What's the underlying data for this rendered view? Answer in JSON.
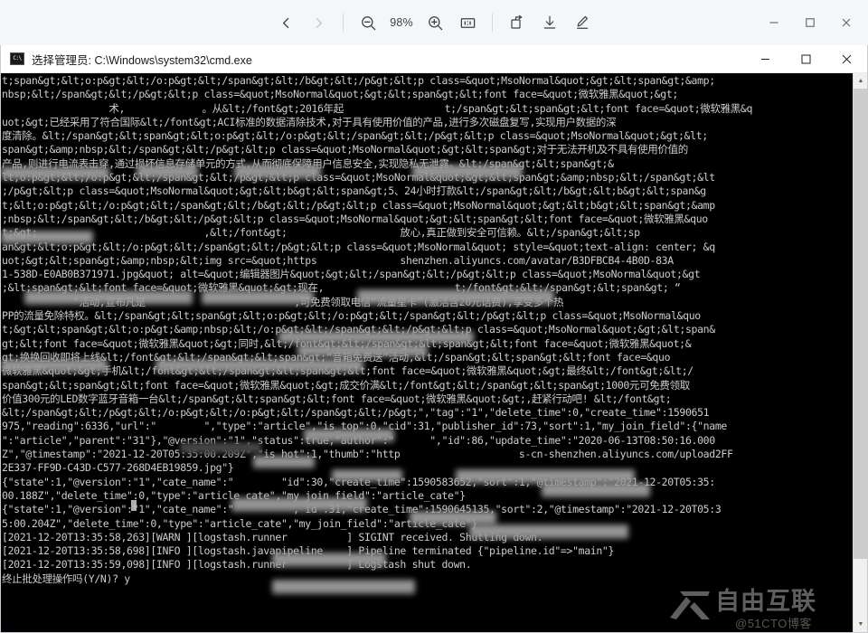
{
  "viewer": {
    "zoom_level": "98%",
    "buttons": {
      "prev": "prev-image",
      "next": "next-image",
      "zoom_out": "zoom-out",
      "zoom_in": "zoom-in",
      "actual_size": "1:1",
      "rotate": "rotate",
      "download": "download",
      "annotate": "annotate",
      "minimize": "−",
      "maximize": "□",
      "close": "✕"
    }
  },
  "cmd_window": {
    "icon_label": "C:\\",
    "title": "选择管理员: C:\\Windows\\system32\\cmd.exe",
    "controls": {
      "minimize": "−",
      "maximize": "□",
      "close": "✕"
    },
    "scrollbar": {
      "up_arrow": "▲",
      "down_arrow": "▼"
    }
  },
  "console": {
    "lines": [
      "t;span&gt;&lt;o:p&gt;&lt;/o:p&gt;&lt;/span&gt;&lt;/b&gt;&lt;/p&gt;&lt;p class=&quot;MsoNormal&quot;&gt;&lt;span&gt;&amp;",
      "nbsp;&lt;/span&gt;&lt;/p&gt;&lt;p class=&quot;MsoNormal&quot;&gt;&lt;span&gt;&lt;font face=&quot;微软雅黑&quot;&gt;",
      "                  术,             。从&lt;/font&gt;2016年起                 t;/span&gt;&lt;span&gt;&lt;font face=&quot;微软雅黑&q",
      "uot;&gt;已经采用了符合国际&lt;/font&gt;ACI标准的数据清除技术,对于具有使用价值的产品,进行多次磁盘复写,实现用户数据的深",
      "度清除。&lt;/span&gt;&lt;span&gt;&lt;o:p&gt;&lt;/o:p&gt;&lt;/span&gt;&lt;/p&gt;&lt;p class=&quot;MsoNormal&quot;&gt;&lt;",
      "span&gt;&amp;nbsp;&lt;/span&gt;&lt;/p&gt;&lt;p class=&quot;MsoNormal&quot;&gt;&lt;span&gt;对于无法开机及不具有使用价值的",
      "产品,则进行电流表击穿,通过损坏信息存储单元的方式,从而彻底保障用户信息安全,实现隐私无泄露。&lt;/span&gt;&lt;span&gt;&",
      "lt;o:p&gt;&lt;/o:p&gt;&lt;/span&gt;&lt;/p&gt;&lt;p class=&quot;MsoNormal&quot;&gt;&lt;span&gt;&amp;nbsp;&lt;/span&gt;&lt",
      ";/p&gt;&lt;p class=&quot;MsoNormal&quot;&gt;&lt;b&gt;&lt;span&gt;5、24小时打款&lt;/span&gt;&lt;/b&gt;&lt;b&gt;&lt;span&g",
      "t;&lt;o:p&gt;&lt;/o:p&gt;&lt;/span&gt;&lt;/b&gt;&lt;/p&gt;&lt;p class=&quot;MsoNormal&quot;&gt;&lt;b&gt;&lt;span&gt;&amp",
      ";nbsp;&lt;/span&gt;&lt;/b&gt;&lt;/p&gt;&lt;p class=&quot;MsoNormal&quot;&gt;&lt;span&gt;&lt;font face=&quot;微软雅黑&quo",
      "t;&gt;                            ,&lt;/font&gt;                   放心,真正做到安全可信赖。&lt;/span&gt;&lt;sp",
      "an&gt;&lt;o:p&gt;&lt;/o:p&gt;&lt;/span&gt;&lt;/p&gt;&lt;p class=&quot;MsoNormal&quot; style=&quot;text-align: center; &q",
      "uot;&gt;&lt;span&gt;&amp;nbsp;&lt;img src=&quot;https              shenzhen.aliyuncs.com/avatar/B3DFBCB4-4B0D-83A",
      "1-538D-E0AB0B371971.jpg&quot; alt=&quot;编辑器图片&quot;&gt;&lt;/span&gt;&lt;/p&gt;&lt;p class=&quot;MsoNormal&quot;&gt",
      ";&lt;span&gt;&lt;font face=&quot;微软雅黑&quot;&gt;现在,                      t;/font&gt;&lt;/span&gt;&lt;span&gt; “",
      "            ”活动,宣布凡是                         ,可免费领取电信“流量星卡”(激活含20元话费),享受多个热",
      "PP的流量免除特权。&lt;/span&gt;&lt;span&gt;&lt;o:p&gt;&lt;/o:p&gt;&lt;/span&gt;&lt;/p&gt;&lt;p class=&quot;MsoNormal&quo",
      "t;&gt;&lt;span&gt;&lt;o:p&gt;&amp;nbsp;&lt;/o:p&gt;&lt;/span&gt;&lt;/p&gt;&lt;p class=&quot;MsoNormal&quot;&gt;&lt;span&",
      "gt;&lt;font face=&quot;微软雅黑&quot;&gt;同时,&lt;/font&gt;&lt;/span&gt;&lt;span&gt;&lt;font face=&quot;微软雅黑&quot;&",
      "gt;换换回收即将上线&lt;/font&gt;&lt;/span&gt;&lt;span&gt;“音箱免费送”活动,&lt;/span&gt;&lt;span&gt;&lt;font face=&quo",
      "微软雅黑&quot;&gt;手机&lt;/font&gt;&lt;/span&gt;&lt;span&gt;&lt;font face=&quot;微软雅黑&quot;&gt;最终&lt;/font&gt;&lt;/",
      "span&gt;&lt;span&gt;&lt;font face=&quot;微软雅黑&quot;&gt;成交价满&lt;/font&gt;&lt;/span&gt;&lt;span&gt;1000元可免费领取",
      "价值300元的LED数字蓝牙音箱一台&lt;/span&gt;&lt;span&gt;&lt;font face=&quot;微软雅黑&quot;&gt;,赶紧行动吧! &lt;/font&gt;",
      "&lt;/span&gt;&lt;/p&gt;&lt;/o:p&gt;&lt;/o:p&gt;&lt;/span&gt;&lt;/p&gt;\",\"tag\":\"1\",\"delete_time\":0,\"create_time\":1590651",
      "975,\"reading\":6336,\"url\":\"        \",\"type\":\"article\",\"is_top\":0,\"cid\":31,\"publisher_id\":73,\"sort\":1,\"my_join_field\":{\"name",
      "\":\"article\",\"parent\":\"31\"},\"@version\":\"1\",\"status\":true,\"author\":\"      \",\"id\":86,\"update_time\":\"2020-06-13T08:50:16.000",
      "Z\",\"@timestamp\":\"2021-12-20T05:35:00.209Z\",\"is_hot\":1,\"thumb\":\"http                    s-cn-shenzhen.aliyuncs.com/upload2FF",
      "2E337-FF9D-C43D-C577-268D4EB19859.jpg\"}",
      "{\"state\":1,\"@version\":\"1\",\"cate_name\":\"        \"id\":30,\"create_time\":1590583652,\"sort\":1,\"@timestamp\":\"2021-12-20T05:35:",
      "00.188Z\",\"delete_time\":0,\"type\":\"article_cate\",\"my_join_field\":\"article_cate\"}",
      "{\"state\":1,\"@version\":\"1\",\"cate_name\":\"          , id .31,\"create_time\":1590645135,\"sort\":2,\"@timestamp\":\"2021-12-20T05:3",
      "5:00.204Z\",\"delete_time\":0,\"type\":\"article_cate\",\"my_join_field\":\"article_cate\"}",
      "[2021-12-20T13:35:58,263][WARN ][logstash.runner          ] SIGINT received. Shutting down.",
      "[2021-12-20T13:35:58,698][INFO ][logstash.javapipeline    ] Pipeline terminated {\"pipeline.id\"=>\"main\"}",
      "[2021-12-20T13:35:59,098][INFO ][logstash.runner          ] Logstash shut down.",
      "终止批处理操作吗(Y/N)? y"
    ]
  },
  "watermark": {
    "brand": "自由互联",
    "handle": "@51CTO博客"
  }
}
